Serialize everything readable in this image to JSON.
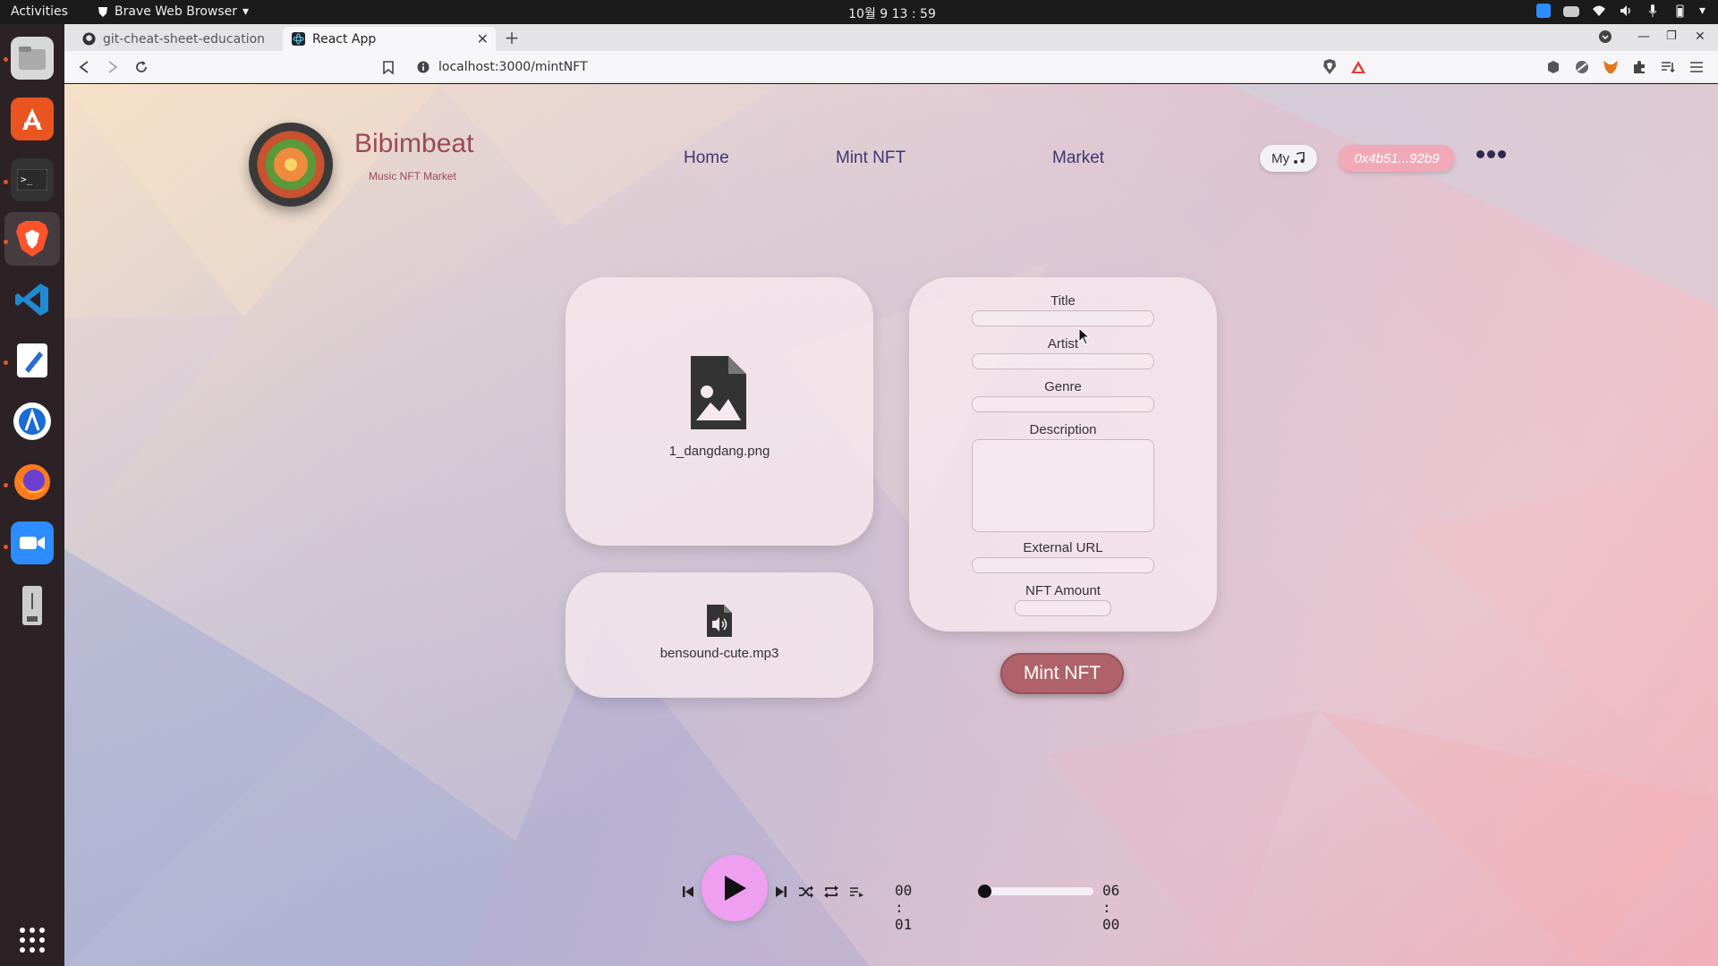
{
  "system": {
    "activities": "Activities",
    "app_name": "Brave Web Browser",
    "clock": "10월 9  13 : 59"
  },
  "dock": {
    "items": [
      "files-icon",
      "app-store-icon",
      "terminal-icon",
      "brave-icon",
      "vscode-icon",
      "text-editor-icon",
      "android-studio-icon",
      "firefox-icon",
      "zoom-icon",
      "usb-drive-icon",
      "app-grid-icon"
    ]
  },
  "browser": {
    "tabs": [
      {
        "label": "git-cheat-sheet-education",
        "icon": "github-icon",
        "active": false
      },
      {
        "label": "React App",
        "icon": "react-icon",
        "active": true
      }
    ],
    "url": "localhost:3000/mintNFT"
  },
  "header": {
    "brand": "Bibimbeat",
    "subtitle": "Music NFT Market",
    "nav": [
      "Home",
      "Mint NFT",
      "Market"
    ],
    "my_label": "My",
    "wallet": "0x4b51...92b9"
  },
  "uploads": {
    "image_file": "1_dangdang.png",
    "audio_file": "bensound-cute.mp3"
  },
  "form": {
    "title_label": "Title",
    "artist_label": "Artist",
    "genre_label": "Genre",
    "description_label": "Description",
    "external_url_label": "External URL",
    "amount_label": "NFT Amount",
    "title_value": "",
    "artist_value": "",
    "genre_value": "",
    "description_value": "",
    "external_url_value": "",
    "amount_value": ""
  },
  "mint_button": "Mint NFT",
  "player": {
    "current_time": "00 : 01",
    "total_time": "06 : 00",
    "progress": 0.003
  },
  "colors": {
    "brand": "#9a4b55",
    "nav": "#3d3673",
    "wallet_bg": "#f2a9b7",
    "mint_button": "#b0626a",
    "play_button": "#ee9ff0"
  }
}
